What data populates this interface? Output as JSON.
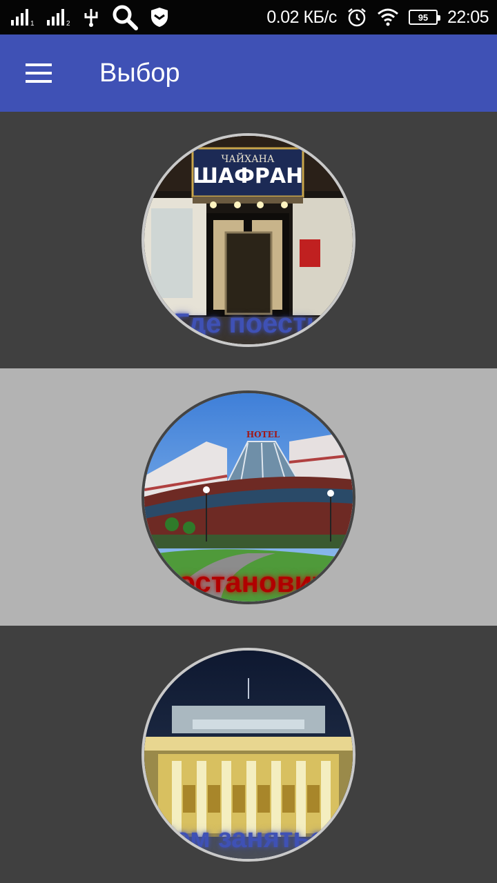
{
  "status_bar": {
    "network_speed": "0.02 КБ/с",
    "battery_level": "95",
    "time": "22:05",
    "icons": [
      "signal-1-icon",
      "signal-2-icon",
      "usb-icon",
      "search-icon",
      "shield-icon",
      "alarm-icon",
      "wifi-icon",
      "battery-icon"
    ]
  },
  "app_bar": {
    "title": "Выбор",
    "menu_icon": "hamburger-menu-icon",
    "color": "#3f51b5"
  },
  "sections": [
    {
      "label": "Где поесть",
      "label_color": "#3f51b5",
      "background": "#404040",
      "sign_top": "ЧАЙХАНА",
      "sign_main": "ШАФРАН"
    },
    {
      "label": "Где остановиться",
      "label_color": "#b00000",
      "background": "#b3b3b3",
      "sign_text": "HOTEL"
    },
    {
      "label": "Чем заняться",
      "label_color": "#3f51b5",
      "background": "#404040"
    }
  ]
}
